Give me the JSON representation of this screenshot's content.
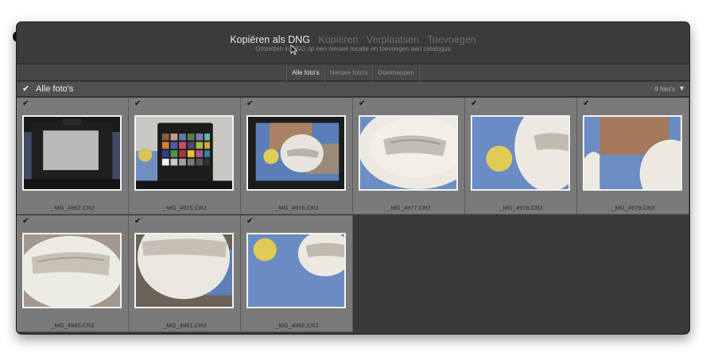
{
  "header": {
    "modes": [
      {
        "label": "Kopiëren als DNG",
        "active": true
      },
      {
        "label": "Kopiëren",
        "active": false
      },
      {
        "label": "Verplaatsen",
        "active": false
      },
      {
        "label": "Toevoegen",
        "active": false
      }
    ],
    "subtitle": "Omzetten in DNG op een nieuwe locatie en toevoegen aan catalogus"
  },
  "filter_tabs": [
    {
      "label": "Alle foto's",
      "active": true
    },
    {
      "label": "Nieuwe foto's",
      "active": false
    },
    {
      "label": "Doelmappen",
      "active": false
    }
  ],
  "section": {
    "check": "✔",
    "title": "Alle foto's",
    "count": "9 foto's",
    "toggle": "▼"
  },
  "photos": [
    {
      "filename": "_MG_4962.CR2",
      "checked": true
    },
    {
      "filename": "_MG_4975.CR2",
      "checked": true
    },
    {
      "filename": "_MG_4976.CR2",
      "checked": true
    },
    {
      "filename": "_MG_4977.CR2",
      "checked": true
    },
    {
      "filename": "_MG_4978.CR2",
      "checked": true
    },
    {
      "filename": "_MG_4979.CR2",
      "checked": true
    },
    {
      "filename": "_MG_4980.CR2",
      "checked": true
    },
    {
      "filename": "_MG_4981.CR2",
      "checked": true
    },
    {
      "filename": "_MG_4982.CR2",
      "checked": true
    }
  ],
  "colors": {
    "dialog_bg": "#3a3a3a",
    "cell_bg": "#7a7a7a",
    "active_text": "#e8e8e8",
    "inactive_text": "#6c6c6c"
  },
  "icons": {
    "checkbox": "check-icon",
    "collapse": "triangle-down-icon",
    "cursor": "pointer-cursor-icon"
  }
}
